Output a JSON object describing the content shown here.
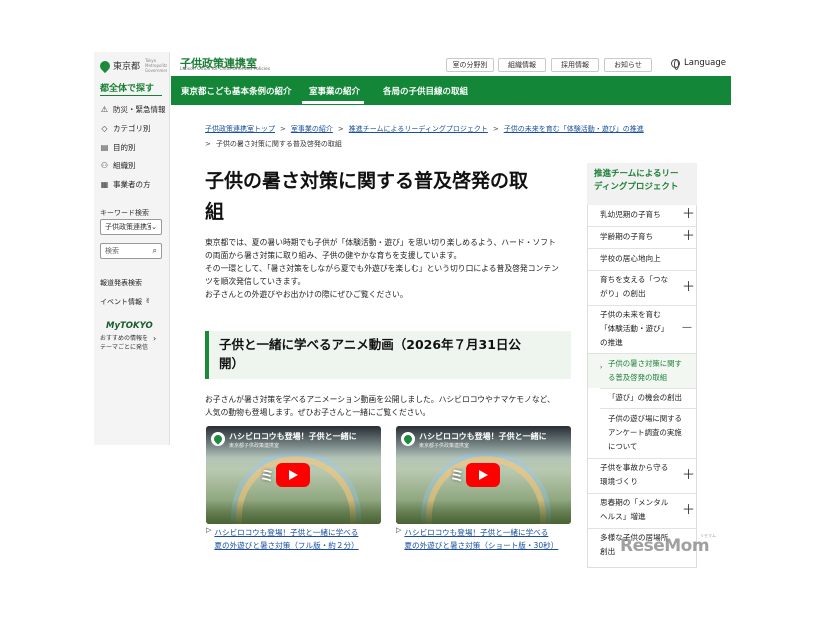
{
  "sidebar": {
    "logo": "東京都",
    "logo_sub": "Tokyo Metropolitan Government",
    "heading": "都全体で探す",
    "items": [
      {
        "icon": "warning-icon",
        "label": "防災・緊急情報"
      },
      {
        "icon": "tag-icon",
        "label": "カテゴリ別"
      },
      {
        "icon": "document-icon",
        "label": "目的別"
      },
      {
        "icon": "org-icon",
        "label": "組織別"
      },
      {
        "icon": "building-icon",
        "label": "事業者の方"
      }
    ],
    "keyword_label": "キーワード検索",
    "select_value": "子供政策連携室",
    "search_placeholder": "検索",
    "report": "報道発表検索",
    "event": "イベント情報",
    "mytokyo": "MyTOKYO",
    "mytokyo_desc1": "おすすめの情報を",
    "mytokyo_desc2": "テーマごとに発信"
  },
  "header": {
    "title": "子供政策連携室",
    "subtitle": "Liaison Office for Child-Oriented Policies",
    "buttons": [
      "室の分野別",
      "組織情報",
      "採用情報",
      "お知らせ"
    ],
    "language": "Language"
  },
  "nav": [
    "東京都こども基本条例の紹介",
    "室事業の紹介",
    "各局の子供目線の取組"
  ],
  "breadcrumb": {
    "links": [
      "子供政策連携室トップ",
      "室事業の紹介",
      "推進チームによるリーディングプロジェクト",
      "子供の未来を育む「体験活動・遊び」の推進"
    ],
    "current": "子供の暑さ対策に関する普及啓発の取組"
  },
  "main": {
    "title_l1": "子供の暑さ対策に関する普及啓発の取",
    "title_l2": "組",
    "intro": [
      "東京都では、夏の暑い時期でも子供が「体験活動・遊び」を思い切り楽しめるよう、ハード・ソフト",
      "の両面から暑さ対策に取り組み、子供の健やかな育ちを支援しています。",
      "その一環として、「暑さ対策をしながら夏でも外遊びを楽しむ」という切り口による普及啓発コンテン",
      "ツを順次発信していきます。",
      "お子さんとの外遊びやお出かけの際にぜひご覧ください。"
    ],
    "section_title_l1": "子供と一緒に学べるアニメ動画（2026年７月31日公",
    "section_title_l2": "開）",
    "section_p": [
      "お子さんが暑さ対策を学べるアニメーション動画を公開しました。ハシビロコウやナマケモノなど、",
      "人気の動物も登場します。ぜひお子さんと一緒にご覧ください。"
    ],
    "videos": [
      {
        "thumb_title": "ハシビロコウも登場！子供と一緒に",
        "channel": "東京都子供政策連携室",
        "overlay": "ミ　に",
        "link_l1": "ハシビロコウも登場！子供と一緒に学べる",
        "link_l2": "夏の外遊びと暑さ対策（フル版・約２分）"
      },
      {
        "thumb_title": "ハシビロコウも登場！子供と一緒に",
        "channel": "東京都子供政策連携室",
        "overlay": "ミ　に",
        "link_l1": "ハシビロコウも登場！子供と一緒に学べる",
        "link_l2": "夏の外遊びと暑さ対策（ショート版・30秒）"
      }
    ]
  },
  "right_sidebar": {
    "heading_l1": "推進チームによるリー",
    "heading_l2": "ディングプロジェクト",
    "items": {
      "i1": "乳幼児期の子育ち",
      "i2": "学齢期の子育ち",
      "i3": "学校の居心地向上",
      "i4_l1": "育ちを支える「つな",
      "i4_l2": "がり」の創出",
      "i5_l1": "子供の未来を育む",
      "i5_l2": "「体験活動・遊び」",
      "i5_l3": "の推進",
      "s1_l1": "子供の暑さ対策に関す",
      "s1_l2": "る普及啓発の取組",
      "s2": "「遊び」の機会の創出",
      "s3_l1": "子供の遊び場に関する",
      "s3_l2": "アンケート調査の実施",
      "s3_l3": "について",
      "i6_l1": "子供を事故から守る",
      "i6_l2": "環境づくり",
      "i7_l1": "思春期の「メンタル",
      "i7_l2": "ヘルス」増進",
      "i8_l1": "多様な子供の居場所",
      "i8_l2": "創出"
    },
    "plus": "＋",
    "minus": "—"
  },
  "watermark": {
    "text": "ReseMom",
    "small": "リセマム"
  }
}
